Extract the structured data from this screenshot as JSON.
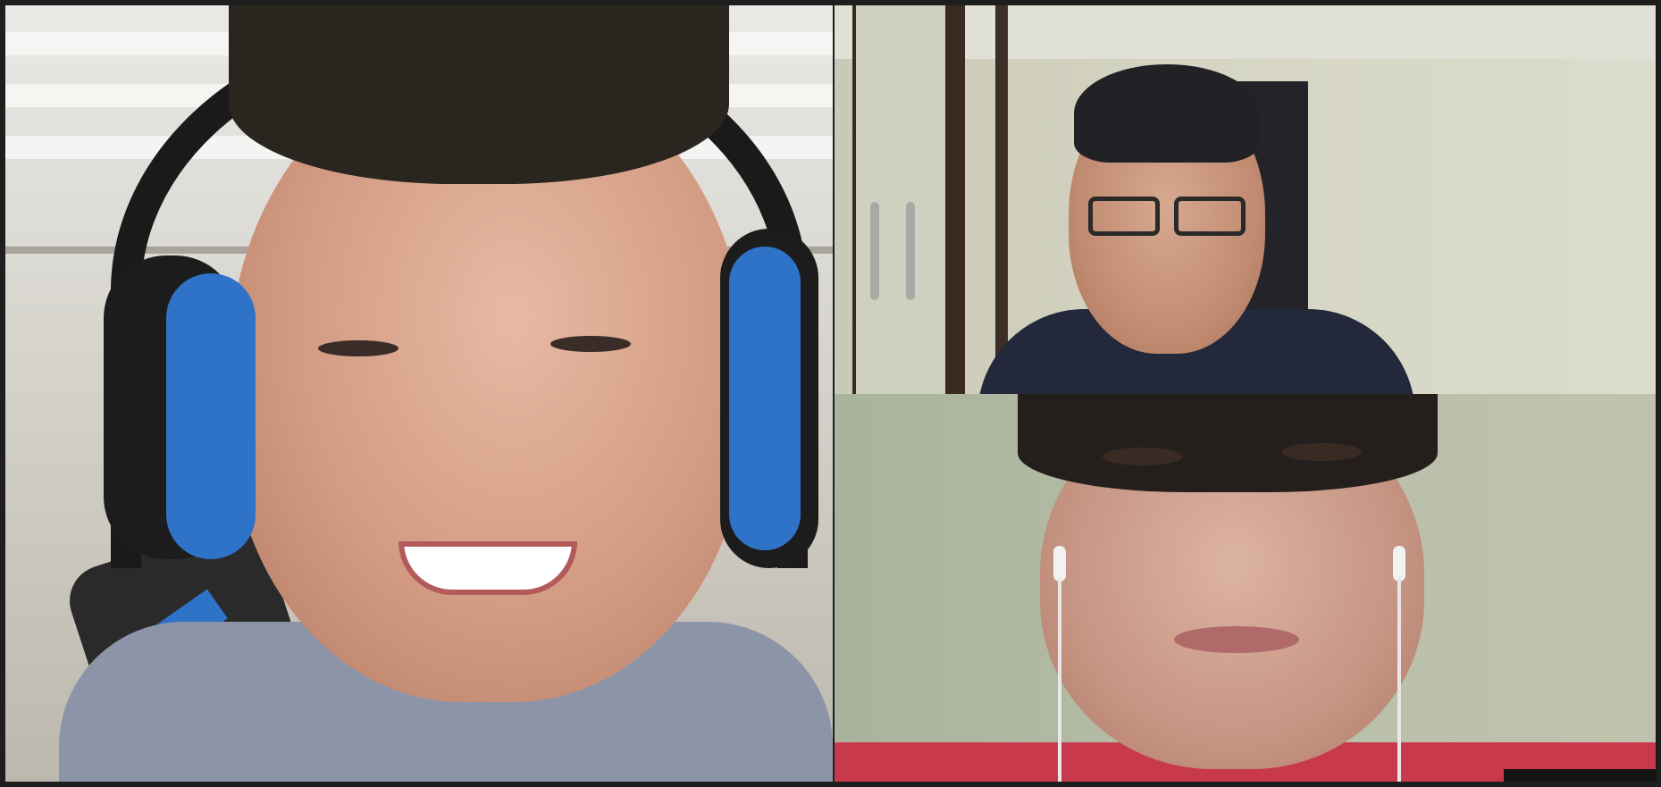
{
  "app": {
    "title": ""
  },
  "participants": [
    {
      "id": "p1",
      "name": ""
    },
    {
      "id": "p2",
      "name": ""
    },
    {
      "id": "p3",
      "name": ""
    }
  ],
  "colors": {
    "background": "#1e1e1e",
    "headset": "#2f73c9",
    "shirt_left": "#8c95a8",
    "shirt_top_right": "#23283a",
    "shirt_bottom_right": "#c63447"
  }
}
